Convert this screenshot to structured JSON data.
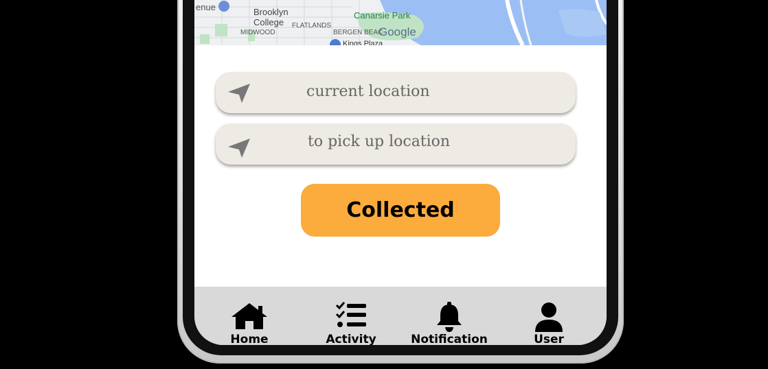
{
  "map": {
    "labels": {
      "avenue": "enue",
      "brooklyn_college": "Brooklyn\nCollege",
      "flatlands": "FLATLANDS",
      "midwood": "MIDWOOD",
      "canarsie_park": "Canarsie Park",
      "bergen_beach": "BERGEN BEAC",
      "google": "Google",
      "kings_plaza": "Kings Plaza"
    }
  },
  "inputs": {
    "current": {
      "placeholder": "current location"
    },
    "pickup": {
      "placeholder": "to pick up location"
    }
  },
  "action": {
    "label": "Collected"
  },
  "nav": {
    "items": [
      {
        "label": "Home",
        "icon": "home-icon"
      },
      {
        "label": "Activity",
        "icon": "checklist-icon"
      },
      {
        "label": "Notification",
        "icon": "bell-icon"
      },
      {
        "label": "User",
        "icon": "user-icon"
      }
    ]
  },
  "colors": {
    "button": "#fbac3c",
    "input_bg": "#eeeae4",
    "nav_bg": "#d9d9d9",
    "map_water": "#9bbff4"
  }
}
